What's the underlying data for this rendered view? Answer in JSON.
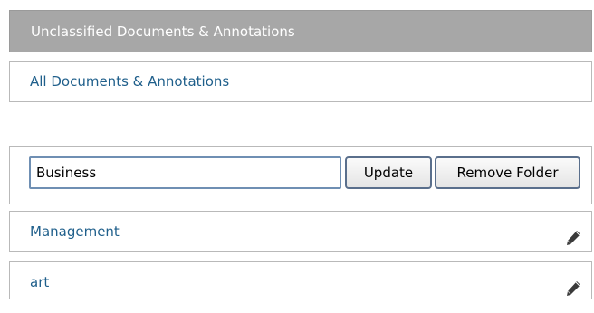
{
  "header": {
    "title": "Unclassified Documents & Annotations"
  },
  "all_link": {
    "label": "All Documents & Annotations"
  },
  "edit_folder": {
    "input_value": "Business",
    "update_label": "Update",
    "remove_label": "Remove Folder"
  },
  "folders": [
    {
      "label": "Management",
      "icon": "pencil-icon"
    },
    {
      "label": "art",
      "icon": "pencil-icon"
    }
  ],
  "colors": {
    "header_bg": "#a7a7a7",
    "link": "#1f5f8b"
  }
}
